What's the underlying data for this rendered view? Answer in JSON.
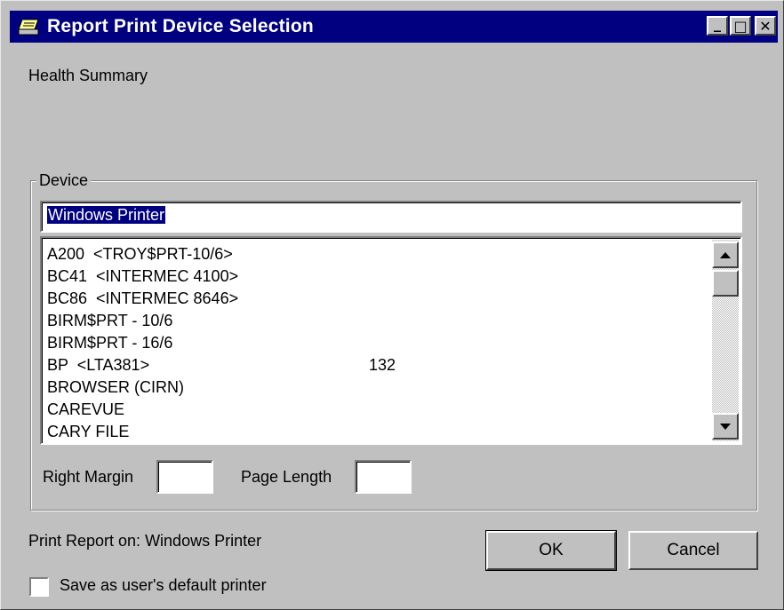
{
  "window": {
    "title": "Report Print Device Selection",
    "buttons": {
      "minimize": "_",
      "maximize": "□",
      "close": "✕"
    }
  },
  "report_name": "Health Summary",
  "device_group": {
    "label": "Device",
    "input_value": "Windows Printer",
    "list": [
      {
        "name": "A200  <TROY$PRT-10/6>",
        "extra": ""
      },
      {
        "name": "BC41  <INTERMEC 4100>",
        "extra": ""
      },
      {
        "name": "BC86  <INTERMEC 8646>",
        "extra": ""
      },
      {
        "name": "BIRM$PRT - 10/6",
        "extra": ""
      },
      {
        "name": "BIRM$PRT - 16/6",
        "extra": ""
      },
      {
        "name": "BP  <LTA381>",
        "extra": "132"
      },
      {
        "name": "BROWSER (CIRN)",
        "extra": ""
      },
      {
        "name": "CAREVUE",
        "extra": ""
      },
      {
        "name": "CARY FILE",
        "extra": ""
      }
    ],
    "right_margin_label": "Right Margin",
    "right_margin_value": "",
    "page_length_label": "Page Length",
    "page_length_value": ""
  },
  "print_on": "Print Report on:  Windows Printer",
  "ok_label": "OK",
  "cancel_label": "Cancel",
  "default_printer_label": "Save as user's default printer",
  "default_printer_checked": false,
  "icons": {
    "title": "printer-icon",
    "scroll_up": "arrow-up-icon",
    "scroll_down": "arrow-down-icon"
  }
}
